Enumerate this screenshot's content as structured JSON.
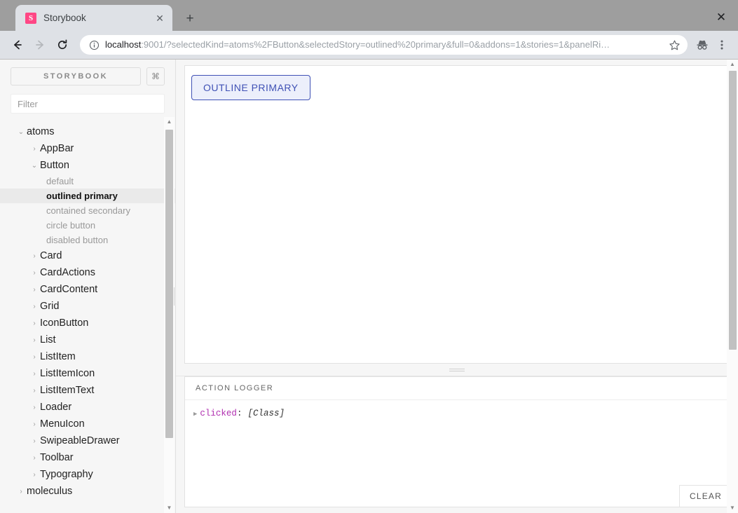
{
  "browser": {
    "tab": {
      "title": "Storybook",
      "favicon_letter": "S",
      "favicon_color": "#ff4785",
      "close_icon": "✕"
    },
    "new_tab_icon": "+",
    "window_close_icon": "✕",
    "nav": {
      "back_icon": "←",
      "forward_icon": "→",
      "reload_icon": "⟳"
    },
    "omnibox": {
      "info_icon": "ⓘ",
      "url_host": "localhost",
      "url_rest": ":9001/?selectedKind=atoms%2FButton&selectedStory=outlined%20primary&full=0&addons=1&stories=1&panelRi…",
      "bookmark_icon": "☆"
    },
    "incognito_icon": "incognito-icon",
    "menu_icon": "⋮"
  },
  "sidebar": {
    "brand": "STORYBOOK",
    "shortcut_icon": "⌘",
    "filter_placeholder": "Filter",
    "filter_value": "",
    "tree": [
      {
        "label": "atoms",
        "level": 1,
        "expanded": true,
        "caret": "⌄"
      },
      {
        "label": "AppBar",
        "level": 2,
        "expanded": false,
        "caret": "›"
      },
      {
        "label": "Button",
        "level": 2,
        "expanded": true,
        "caret": "⌄"
      },
      {
        "label": "Card",
        "level": 2,
        "expanded": false,
        "caret": "›"
      },
      {
        "label": "CardActions",
        "level": 2,
        "expanded": false,
        "caret": "›"
      },
      {
        "label": "CardContent",
        "level": 2,
        "expanded": false,
        "caret": "›"
      },
      {
        "label": "Grid",
        "level": 2,
        "expanded": false,
        "caret": "›"
      },
      {
        "label": "IconButton",
        "level": 2,
        "expanded": false,
        "caret": "›"
      },
      {
        "label": "List",
        "level": 2,
        "expanded": false,
        "caret": "›"
      },
      {
        "label": "ListItem",
        "level": 2,
        "expanded": false,
        "caret": "›"
      },
      {
        "label": "ListItemIcon",
        "level": 2,
        "expanded": false,
        "caret": "›"
      },
      {
        "label": "ListItemText",
        "level": 2,
        "expanded": false,
        "caret": "›"
      },
      {
        "label": "Loader",
        "level": 2,
        "expanded": false,
        "caret": "›"
      },
      {
        "label": "MenuIcon",
        "level": 2,
        "expanded": false,
        "caret": "›"
      },
      {
        "label": "SwipeableDrawer",
        "level": 2,
        "expanded": false,
        "caret": "›"
      },
      {
        "label": "Toolbar",
        "level": 2,
        "expanded": false,
        "caret": "›"
      },
      {
        "label": "Typography",
        "level": 2,
        "expanded": false,
        "caret": "›"
      },
      {
        "label": "moleculus",
        "level": 1,
        "expanded": false,
        "caret": "›"
      }
    ],
    "button_stories": [
      {
        "label": "default",
        "selected": false
      },
      {
        "label": "outlined primary",
        "selected": true
      },
      {
        "label": "contained secondary",
        "selected": false
      },
      {
        "label": "circle button",
        "selected": false
      },
      {
        "label": "disabled button",
        "selected": false
      }
    ],
    "scroll_up_icon": "▲",
    "scroll_down_icon": "▼"
  },
  "preview": {
    "button_label": "OUTLINE PRIMARY",
    "button_border_color": "#3f51b5",
    "button_bg_color": "#eceffb",
    "button_text_color": "#3f51b5",
    "scroll_up_icon": "▲",
    "scroll_down_icon": "▼"
  },
  "panel": {
    "tabs": [
      {
        "label": "ACTION LOGGER",
        "active": true
      }
    ],
    "logs": [
      {
        "caret": "▶",
        "key": "clicked",
        "colon": ":",
        "value": "[Class]"
      }
    ],
    "clear_label": "CLEAR"
  }
}
